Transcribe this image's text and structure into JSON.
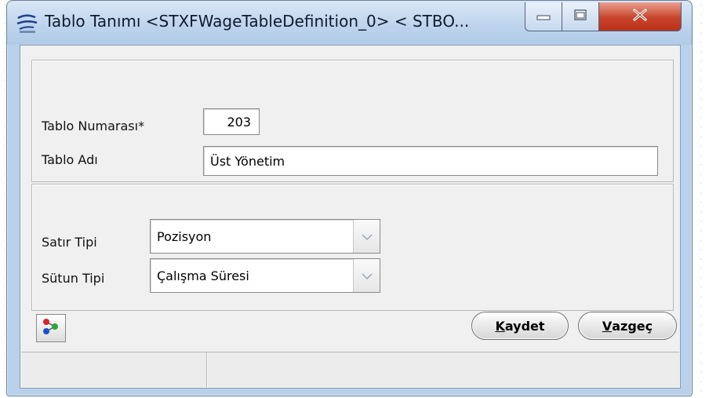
{
  "window": {
    "title": "Tablo Tanımı <STXFWageTableDefinition_0> < STBO...",
    "icon": "app-logo-icon",
    "controls": [
      "minimize-icon",
      "maximize-icon",
      "close-icon"
    ]
  },
  "table_section": {
    "number_label": "Tablo Numarası*",
    "number_value": "203",
    "name_label": "Tablo Adı",
    "name_value": "Üst Yönetim"
  },
  "type_section": {
    "row_type_label": "Satır Tipi",
    "row_type_value": "Pozisyon",
    "column_type_label": "Sütun Tipi",
    "column_type_value": "Çalışma Süresi"
  },
  "actions": {
    "tool_icon": "colored-nodes-icon",
    "save_mnemonic": "K",
    "save_rest": "aydet",
    "cancel_mnemonic": "V",
    "cancel_rest": "azgeç"
  },
  "statusbar": {
    "cell1": "",
    "cell2": ""
  },
  "colors": {
    "titlebar": "#bcd3ec",
    "close_button": "#c8442a",
    "client_bg": "#f0f0f0"
  }
}
